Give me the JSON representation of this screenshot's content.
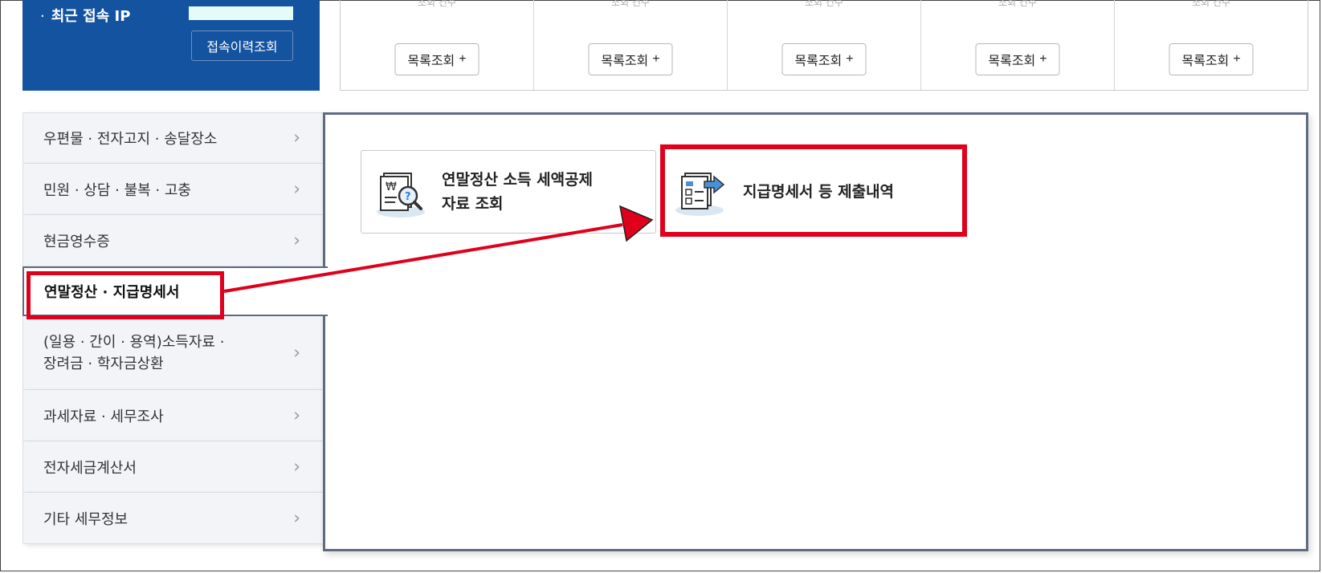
{
  "ip_panel": {
    "label": "최근 접속 IP",
    "bullet": "·",
    "history_button": "접속이력조회"
  },
  "list_panels": [
    {
      "top_text": "조회 건수",
      "button": "목록조회",
      "plus": "+"
    },
    {
      "top_text": "조회 건수",
      "button": "목록조회",
      "plus": "+"
    },
    {
      "top_text": "조회 건수",
      "button": "목록조회",
      "plus": "+"
    },
    {
      "top_text": "조회 건수",
      "button": "목록조회",
      "plus": "+"
    },
    {
      "top_text": "조회 건수",
      "button": "목록조회",
      "plus": "+"
    }
  ],
  "sidebar": {
    "items": [
      {
        "label": "우편물 · 전자고지 · 송달장소"
      },
      {
        "label": "민원 · 상담 · 불복 · 고충"
      },
      {
        "label": "현금영수증"
      },
      {
        "label": "연말정산 · 지급명세서",
        "active": true
      },
      {
        "label": "(일용 · 간이 · 용역)소득자료 ·\n장려금 · 학자금상환"
      },
      {
        "label": "과세자료 · 세무조사"
      },
      {
        "label": "전자세금계산서"
      },
      {
        "label": "기타 세무정보"
      }
    ]
  },
  "content": {
    "cards": [
      {
        "label": "연말정산 소득 세액공제\n자료 조회",
        "icon": "receipt-search-icon"
      },
      {
        "label": "지급명세서 등 제출내역",
        "icon": "document-submit-icon"
      }
    ]
  },
  "colors": {
    "blue_panel": "#1453a0",
    "highlight_red": "#e0001c",
    "active_border": "#5e6b80"
  }
}
